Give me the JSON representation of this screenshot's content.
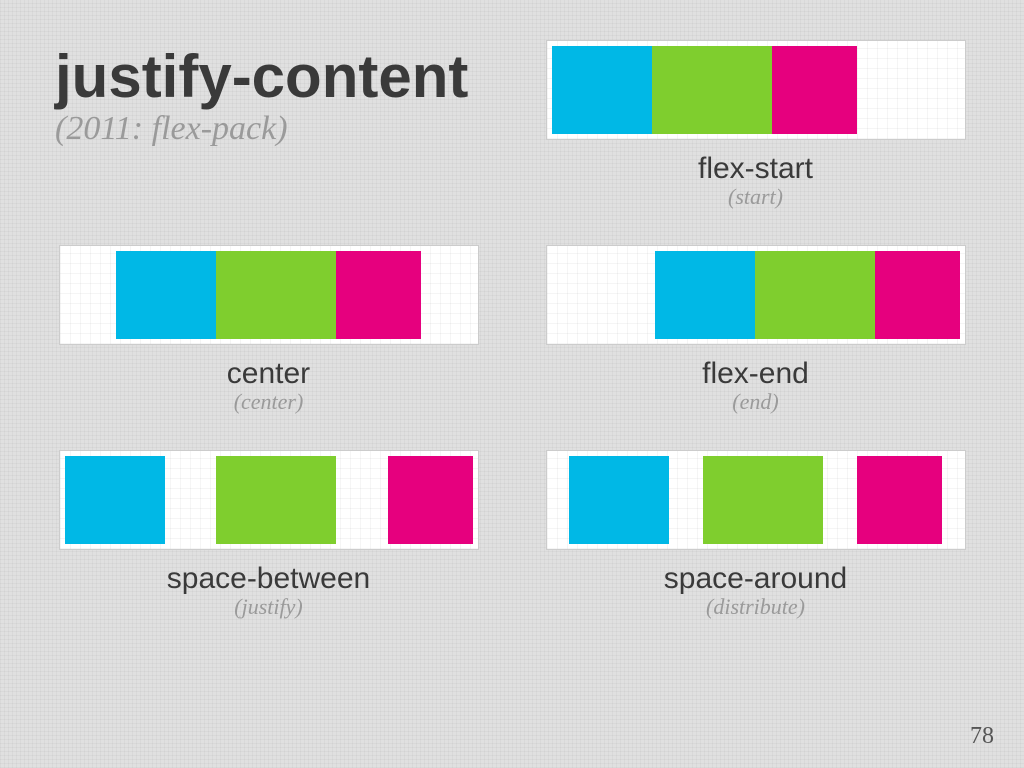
{
  "header": {
    "title": "justify-content",
    "subtitle": "(2011: flex-pack)"
  },
  "colors": {
    "cyan": "#00b8e6",
    "green": "#7fce2e",
    "magenta": "#e6007e"
  },
  "examples": [
    {
      "key": "flex-start",
      "label": "flex-start",
      "sublabel": "(start)"
    },
    {
      "key": "center",
      "label": "center",
      "sublabel": "(center)"
    },
    {
      "key": "flex-end",
      "label": "flex-end",
      "sublabel": "(end)"
    },
    {
      "key": "space-between",
      "label": "space-between",
      "sublabel": "(justify)"
    },
    {
      "key": "space-around",
      "label": "space-around",
      "sublabel": "(distribute)"
    }
  ],
  "page_number": "78"
}
